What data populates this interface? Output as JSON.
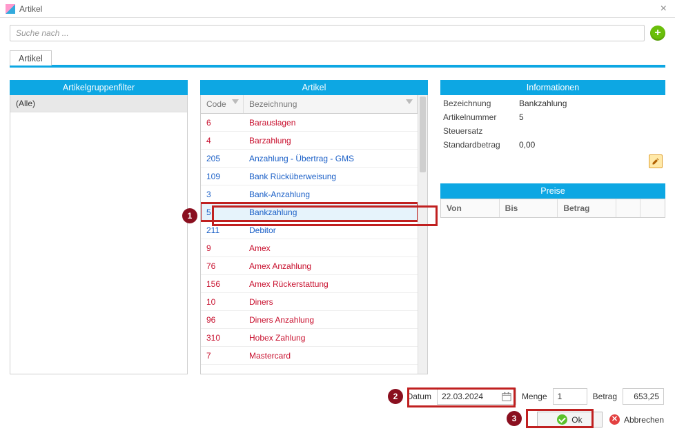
{
  "window": {
    "title": "Artikel"
  },
  "search": {
    "placeholder": "Suche nach ..."
  },
  "tabs": [
    {
      "label": "Artikel",
      "active": true
    }
  ],
  "leftPanel": {
    "title": "Artikelgruppenfilter",
    "items": [
      {
        "label": "(Alle)"
      }
    ]
  },
  "midPanel": {
    "title": "Artikel",
    "columns": {
      "code": "Code",
      "bez": "Bezeichnung"
    },
    "rows": [
      {
        "code": "6",
        "bez": "Barauslagen",
        "color": "red"
      },
      {
        "code": "4",
        "bez": "Barzahlung",
        "color": "red"
      },
      {
        "code": "205",
        "bez": "Anzahlung - Übertrag - GMS",
        "color": "blue"
      },
      {
        "code": "109",
        "bez": "Bank Rücküberweisung",
        "color": "blue"
      },
      {
        "code": "3",
        "bez": "Bank-Anzahlung",
        "color": "blue"
      },
      {
        "code": "5",
        "bez": "Bankzahlung",
        "color": "blue",
        "selected": true
      },
      {
        "code": "211",
        "bez": "Debitor",
        "color": "blue"
      },
      {
        "code": "9",
        "bez": "Amex",
        "color": "red"
      },
      {
        "code": "76",
        "bez": "Amex Anzahlung",
        "color": "red"
      },
      {
        "code": "156",
        "bez": "Amex Rückerstattung",
        "color": "red"
      },
      {
        "code": "10",
        "bez": "Diners",
        "color": "red"
      },
      {
        "code": "96",
        "bez": "Diners Anzahlung",
        "color": "red"
      },
      {
        "code": "310",
        "bez": "Hobex Zahlung",
        "color": "red"
      },
      {
        "code": "7",
        "bez": "Mastercard",
        "color": "red"
      }
    ]
  },
  "infoPanel": {
    "title": "Informationen",
    "rows": [
      {
        "label": "Bezeichnung",
        "value": "Bankzahlung"
      },
      {
        "label": "Artikelnummer",
        "value": "5"
      },
      {
        "label": "Steuersatz",
        "value": ""
      },
      {
        "label": "Standardbetrag",
        "value": "0,00"
      }
    ]
  },
  "preisePanel": {
    "title": "Preise",
    "columns": [
      "Von",
      "Bis",
      "Betrag"
    ]
  },
  "bottom": {
    "datumLabel": "Datum",
    "datumValue": "22.03.2024",
    "mengeLabel": "Menge",
    "mengeValue": "1",
    "betragLabel": "Betrag",
    "betragValue": "653,25",
    "okLabel": "Ok",
    "cancelLabel": "Abbrechen"
  },
  "callouts": [
    {
      "n": "1"
    },
    {
      "n": "2"
    },
    {
      "n": "3"
    }
  ]
}
